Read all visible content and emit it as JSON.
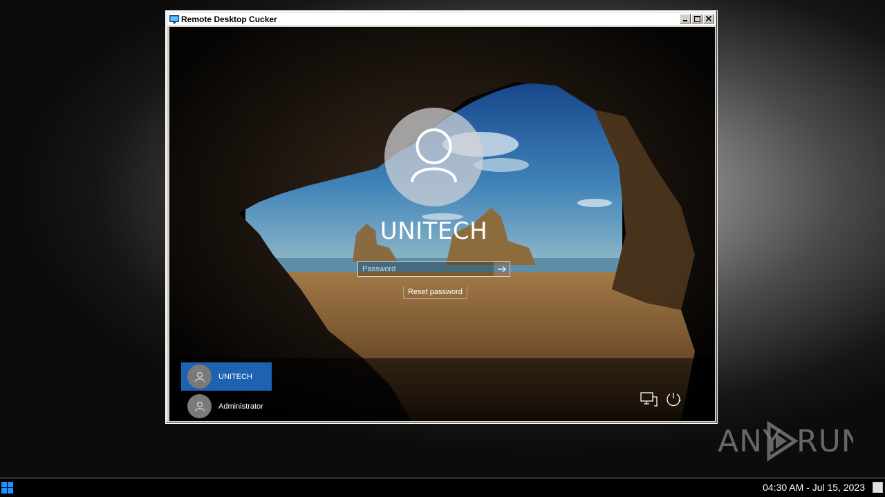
{
  "window": {
    "title": "Remote Desktop Cucker",
    "controls": [
      "minimize",
      "maximize",
      "close"
    ]
  },
  "login": {
    "username": "UNITECH",
    "password_placeholder": "Password",
    "reset_password": "Reset password",
    "users": [
      {
        "name": "UNITECH",
        "selected": true
      },
      {
        "name": "Administrator",
        "selected": false
      }
    ],
    "corner_icons": [
      "network-icon",
      "power-icon"
    ]
  },
  "watermark": {
    "text": "ANY RUN"
  },
  "taskbar": {
    "clock": "04:30 AM - Jul 15, 2023"
  },
  "colors": {
    "selected_user": "#1e63b0",
    "accent": "#0078d7"
  }
}
